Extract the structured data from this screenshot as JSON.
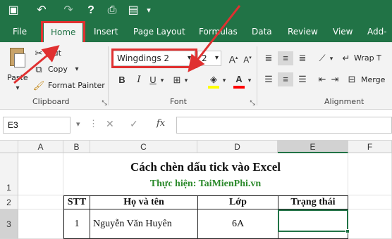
{
  "ribbon_tabs": [
    "File",
    "Home",
    "Insert",
    "Page Layout",
    "Formulas",
    "Data",
    "Review",
    "View",
    "Add-in"
  ],
  "clipboard": {
    "paste": "Paste",
    "cut": "Cut",
    "copy": "Copy",
    "format_painter": "Format Painter",
    "group": "Clipboard"
  },
  "font": {
    "name": "Wingdings 2",
    "size": "2",
    "group": "Font",
    "bold": "B",
    "italic": "I",
    "underline": "U"
  },
  "alignment": {
    "wrap": "Wrap T",
    "merge": "Merge",
    "group": "Alignment"
  },
  "formula_bar": {
    "name_box": "E3",
    "fx": "fx",
    "value": ""
  },
  "columns": [
    "A",
    "B",
    "C",
    "D",
    "E",
    "F"
  ],
  "rows": [
    "1",
    "2",
    "3"
  ],
  "sheet": {
    "title": "Cách chèn dấu tick vào Excel",
    "subtitle": "Thực hiện: TaiMienPhi.vn",
    "headers": [
      "STT",
      "Họ và tên",
      "Lớp",
      "Trạng thái"
    ],
    "row1": [
      "1",
      "Nguyễn Văn Huyên",
      "6A",
      ""
    ]
  },
  "colors": {
    "excel_green": "#217346",
    "annotation_red": "#e03030",
    "subtitle_green": "#2e8b2e"
  }
}
